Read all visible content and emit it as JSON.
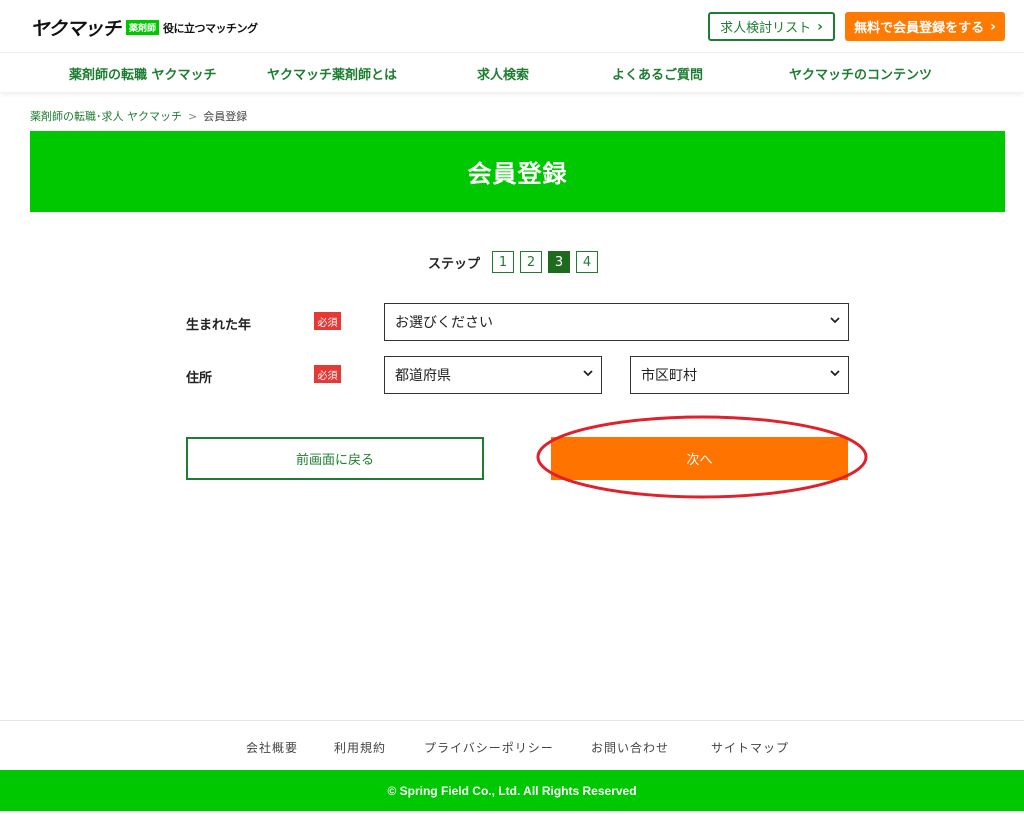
{
  "header": {
    "logo_text": "ヤクマッチ",
    "logo_badge": "薬剤師",
    "logo_tagline": "役に立つマッチング",
    "job_list_button": "求人検討リスト",
    "register_button": "無料で会員登録をする"
  },
  "nav": {
    "items": [
      {
        "label": "薬剤師の転職 ヤクマッチ"
      },
      {
        "label": "ヤクマッチ薬剤師とは"
      },
      {
        "label": "求人検索"
      },
      {
        "label": "よくあるご質問"
      },
      {
        "label": "ヤクマッチのコンテンツ"
      }
    ]
  },
  "breadcrumb": {
    "home": "薬剤師の転職･求人 ヤクマッチ",
    "separator": ">",
    "current": "会員登録"
  },
  "banner": {
    "title": "会員登録"
  },
  "steps": {
    "label": "ステップ",
    "items": [
      "1",
      "2",
      "3",
      "4"
    ],
    "current": 3
  },
  "form": {
    "birth_year": {
      "label": "生まれた年",
      "required": "必須",
      "value": "お選びください"
    },
    "address": {
      "label": "住所",
      "required": "必須",
      "prefecture_value": "都道府県",
      "city_value": "市区町村"
    }
  },
  "buttons": {
    "back": "前画面に戻る",
    "next": "次へ"
  },
  "footer": {
    "links": [
      "会社概要",
      "利用規約",
      "プライバシーポリシー",
      "お問い合わせ",
      "サイトマップ"
    ],
    "copyright": "© Spring Field Co., Ltd. All Rights Reserved"
  },
  "colors": {
    "brand_green": "#00c800",
    "dark_green": "#1e7d32",
    "accent_orange": "#ff7300",
    "required_red": "#e53935",
    "highlight_red": "#e0202a"
  }
}
